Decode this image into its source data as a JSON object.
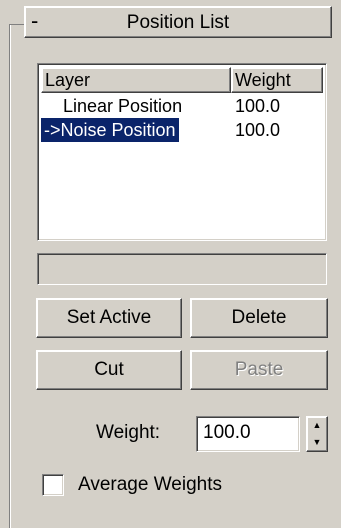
{
  "rollout": {
    "title": "Position List",
    "collapse_symbol": "-"
  },
  "list": {
    "headers": {
      "layer": "Layer",
      "weight": "Weight"
    },
    "rows": [
      {
        "layer": "Linear Position",
        "weight": "100.0",
        "selected": false
      },
      {
        "layer": "->Noise Position",
        "weight": "100.0",
        "selected": true
      }
    ]
  },
  "name_field": {
    "value": ""
  },
  "buttons": {
    "set_active": "Set Active",
    "delete": "Delete",
    "cut": "Cut",
    "paste": "Paste"
  },
  "weight": {
    "label": "Weight:",
    "value": "100.0"
  },
  "average_weights": {
    "label": "Average Weights",
    "checked": false
  },
  "colors": {
    "panel": "#d4d0c8",
    "selection": "#0a246a",
    "disabled_text": "#808080"
  }
}
